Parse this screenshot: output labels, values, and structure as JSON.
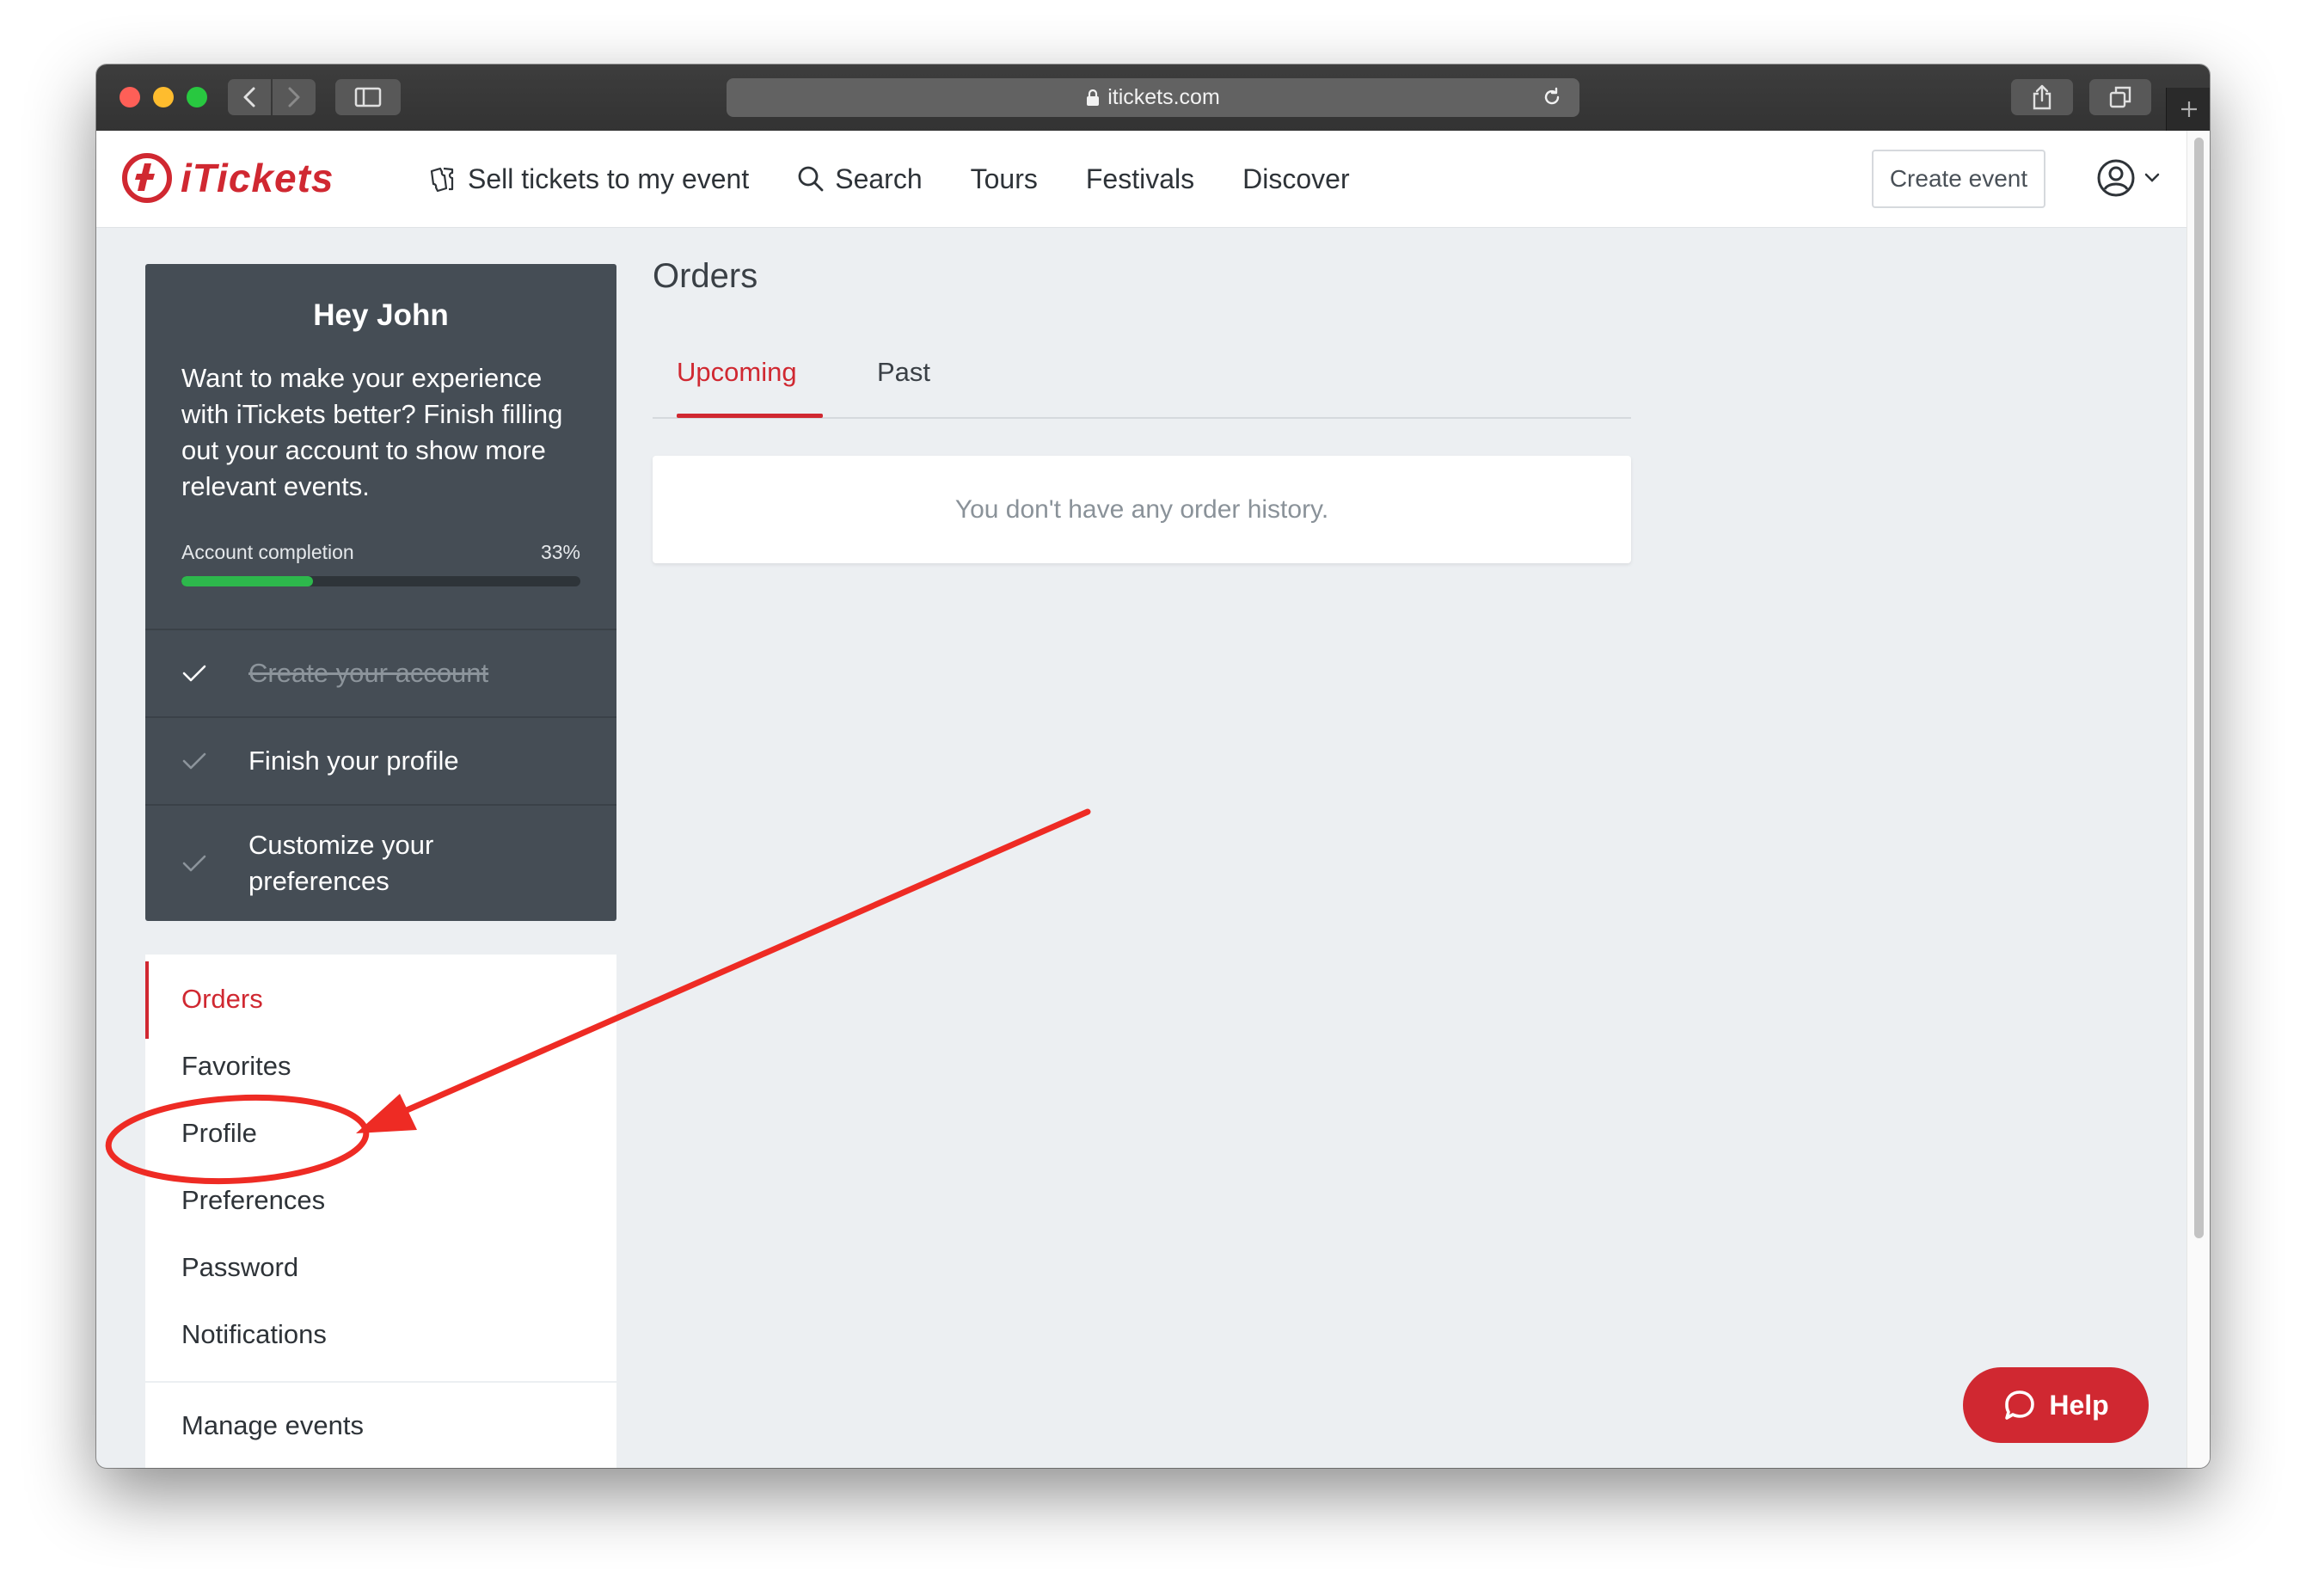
{
  "browser": {
    "url": "itickets.com",
    "icons": {
      "back": "chevron-left-icon",
      "forward": "chevron-right-icon",
      "sidebar": "sidebar-icon",
      "lock": "lock-icon",
      "reload": "reload-icon",
      "share": "share-icon",
      "tabs": "tabs-overview-icon",
      "new_tab": "plus-icon"
    },
    "traffic_lights": [
      "#fe5f57",
      "#febc2e",
      "#28c840"
    ]
  },
  "header": {
    "logo_text": "iTickets",
    "nav": [
      {
        "label": "Sell tickets to my event",
        "icon": "ticket-icon"
      },
      {
        "label": "Search",
        "icon": "search-icon"
      },
      {
        "label": "Tours"
      },
      {
        "label": "Festivals"
      },
      {
        "label": "Discover"
      }
    ],
    "create_event_label": "Create event",
    "account_icon": "user-circle-icon"
  },
  "profile_card": {
    "greeting": "Hey John",
    "intro": "Want to make your experience with iTickets better? Finish filling out your account to show more relevant events.",
    "completion_label": "Account completion",
    "completion_percent_text": "33%",
    "completion_value": 0.33,
    "tasks": [
      {
        "label": "Create your account",
        "done": true
      },
      {
        "label": "Finish your profile",
        "done": false
      },
      {
        "label": "Customize your preferences",
        "done": false
      }
    ]
  },
  "menu": {
    "items": [
      {
        "label": "Orders",
        "active": true
      },
      {
        "label": "Favorites",
        "active": false
      },
      {
        "label": "Profile",
        "active": false
      },
      {
        "label": "Preferences",
        "active": false
      },
      {
        "label": "Password",
        "active": false
      },
      {
        "label": "Notifications",
        "active": false
      }
    ],
    "manage_events_label": "Manage events"
  },
  "main": {
    "title": "Orders",
    "tabs": [
      {
        "label": "Upcoming",
        "active": true
      },
      {
        "label": "Past",
        "active": false
      }
    ],
    "empty_message": "You don't have any order history."
  },
  "help": {
    "label": "Help",
    "icon": "chat-bubble-icon"
  },
  "colors": {
    "brand_red": "#d02831",
    "sidebar_dark": "#454d55",
    "progress_green": "#2db84c",
    "annotation_red": "#ee2b24",
    "page_bg": "#eceff2"
  }
}
